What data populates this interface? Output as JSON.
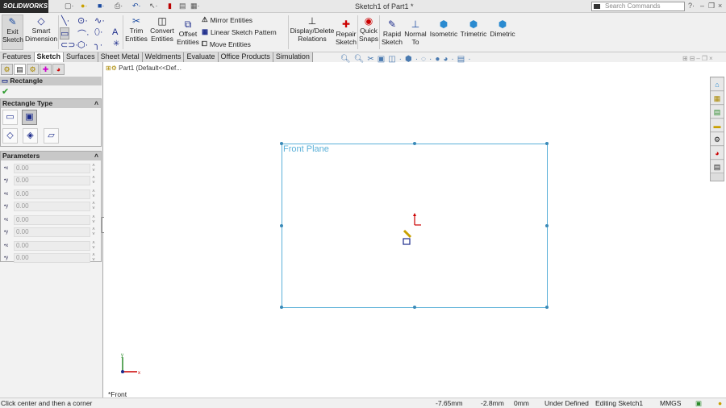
{
  "app": {
    "logo": "SOLIDWORKS",
    "title": "Sketch1 of Part1 *",
    "search_placeholder": "Search Commands"
  },
  "ribbon": {
    "exit_sketch": "Exit Sketch",
    "smart_dimension": "Smart Dimension",
    "trim": "Trim Entities",
    "convert": "Convert Entities",
    "offset": "Offset Entities",
    "mirror": "Mirror Entities",
    "linear_pattern": "Linear Sketch Pattern",
    "move": "Move Entities",
    "relations": "Display/Delete Relations",
    "repair": "Repair Sketch",
    "quick_snaps": "Quick Snaps",
    "rapid": "Rapid Sketch",
    "normal_to": "Normal To",
    "isometric": "Isometric",
    "trimetric": "Trimetric",
    "dimetric": "Dimetric"
  },
  "tabs": [
    "Features",
    "Sketch",
    "Surfaces",
    "Sheet Metal",
    "Weldments",
    "Evaluate",
    "Office Products",
    "Simulation"
  ],
  "panel": {
    "title": "Rectangle",
    "rect_type": "Rectangle Type",
    "parameters": "Parameters",
    "params": [
      {
        "axis": "x",
        "value": "0.00"
      },
      {
        "axis": "y",
        "value": "0.00"
      },
      {
        "axis": "x",
        "value": "0.00"
      },
      {
        "axis": "y",
        "value": "0.00"
      },
      {
        "axis": "x",
        "value": "0.00"
      },
      {
        "axis": "y",
        "value": "0.00"
      },
      {
        "axis": "x",
        "value": "0.00"
      },
      {
        "axis": "y",
        "value": "0.00"
      }
    ]
  },
  "tree": {
    "root": "Part1  (Default<<Def..."
  },
  "canvas": {
    "plane_label": "Front Plane",
    "view_label": "*Front"
  },
  "status": {
    "hint": "Click center and then a corner",
    "x": "-7.65mm",
    "y": "-2.8mm",
    "z": "0mm",
    "state": "Under Defined",
    "mode": "Editing Sketch1",
    "units": "MMGS"
  }
}
